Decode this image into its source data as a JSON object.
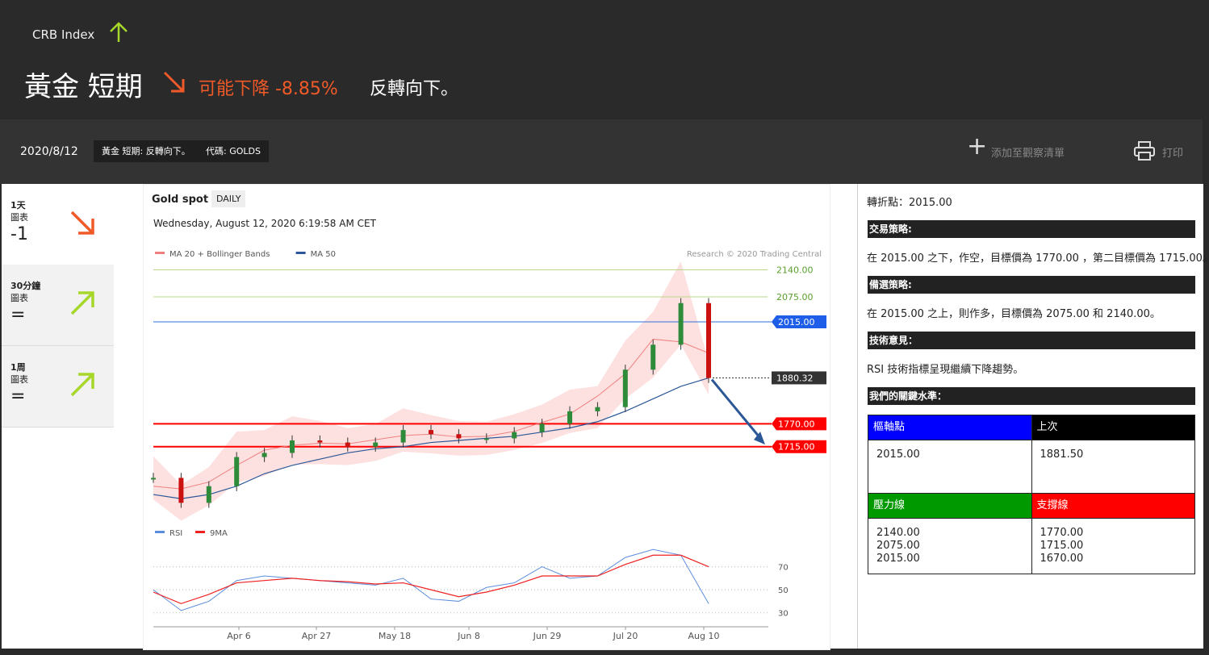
{
  "header": {
    "index_label": "CRB Index",
    "headline": "黃金 短期",
    "forecast": "可能下降 -8.85%",
    "summary": "反轉向下。"
  },
  "toolbar": {
    "date": "2020/8/12",
    "tag1": "黃金 短期: 反轉向下。",
    "tag2": "代碼: GOLDS",
    "watchlist": "添加至觀察清單",
    "print": "打印"
  },
  "timeframes": [
    {
      "line1": "1天",
      "line2": "圖表",
      "value": "-1",
      "direction": "down"
    },
    {
      "line1": "30分鐘",
      "line2": "圖表",
      "value": "=",
      "direction": "up"
    },
    {
      "line1": "1周",
      "line2": "圖表",
      "value": "=",
      "direction": "up"
    }
  ],
  "colors": {
    "down": "#f05a28",
    "up": "#a6d72a",
    "blue": "#0000ff",
    "black": "#000000",
    "green": "#009900",
    "red": "#ff0000"
  },
  "chart_data": {
    "type": "line",
    "title": "Gold spot",
    "period": "DAILY",
    "timestamp": "Wednesday, August 12, 2020 6:19:58 AM CET",
    "credit": "Research © 2020 Trading Central",
    "legend": [
      {
        "name": "MA 20 + Bollinger Bands",
        "color": "#f08080"
      },
      {
        "name": "MA 50",
        "color": "#2b5797"
      }
    ],
    "x_ticks": [
      "Apr 6",
      "Apr 27",
      "May 18",
      "Jun 8",
      "Jun 29",
      "Jul 20",
      "Aug 10"
    ],
    "x": [
      1,
      8,
      15,
      22,
      29,
      36,
      43,
      50,
      57,
      64,
      71,
      78,
      85,
      92,
      99,
      106,
      113,
      120,
      127,
      134,
      141
    ],
    "price": [
      1640,
      1580,
      1620,
      1690,
      1700,
      1730,
      1725,
      1715,
      1725,
      1755,
      1745,
      1735,
      1735,
      1750,
      1770,
      1800,
      1810,
      1900,
      1960,
      2060,
      1880
    ],
    "ma50": [
      1600,
      1590,
      1600,
      1620,
      1650,
      1670,
      1685,
      1700,
      1710,
      1715,
      1725,
      1730,
      1735,
      1740,
      1750,
      1760,
      1775,
      1800,
      1830,
      1860,
      1880
    ],
    "levels": [
      {
        "value": 2140.0,
        "label": "2140.00",
        "kind": "target"
      },
      {
        "value": 2075.0,
        "label": "2075.00",
        "kind": "target"
      },
      {
        "value": 2015.0,
        "label": "2015.00",
        "kind": "pivot"
      },
      {
        "value": 1880.32,
        "label": "1880.32",
        "kind": "last"
      },
      {
        "value": 1770.0,
        "label": "1770.00",
        "kind": "support"
      },
      {
        "value": 1715.0,
        "label": "1715.00",
        "kind": "support"
      }
    ],
    "rsi_legend": [
      {
        "name": "RSI",
        "color": "#5b8ddc"
      },
      {
        "name": "9MA",
        "color": "#ee2222"
      }
    ],
    "rsi_ticks": [
      70,
      50,
      30
    ],
    "rsi": [
      50,
      32,
      40,
      58,
      62,
      60,
      58,
      56,
      54,
      60,
      42,
      40,
      52,
      56,
      70,
      60,
      62,
      78,
      85,
      80,
      38
    ],
    "rsi_ma": [
      48,
      38,
      46,
      56,
      58,
      60,
      58,
      57,
      55,
      56,
      50,
      44,
      48,
      54,
      62,
      62,
      62,
      72,
      80,
      80,
      70
    ]
  },
  "right": {
    "pivot_line": "轉折點：2015.00",
    "strategy_h": "交易策略:",
    "strategy_t": "在 2015.00 之下，作空，目標價為 1770.00 ，第二目標價為 1715.00。",
    "alt_h": "備選策略:",
    "alt_t": "在 2015.00 之上，則作多，目標價為 2075.00 和 2140.00。",
    "tech_h": "技術意見：",
    "tech_t": "RSI 技術指標呈現繼續下降趨勢。",
    "levels_h": "我們的關鍵水準：",
    "pivot_h": "樞軸點",
    "last_h": "上次",
    "pivot_v": "2015.00",
    "last_v": "1881.50",
    "res_h": "壓力線",
    "sup_h": "支撐線",
    "res_1": "2140.00",
    "res_2": "2075.00",
    "res_3": "2015.00",
    "sup_1": "1770.00",
    "sup_2": "1715.00",
    "sup_3": "1670.00"
  }
}
